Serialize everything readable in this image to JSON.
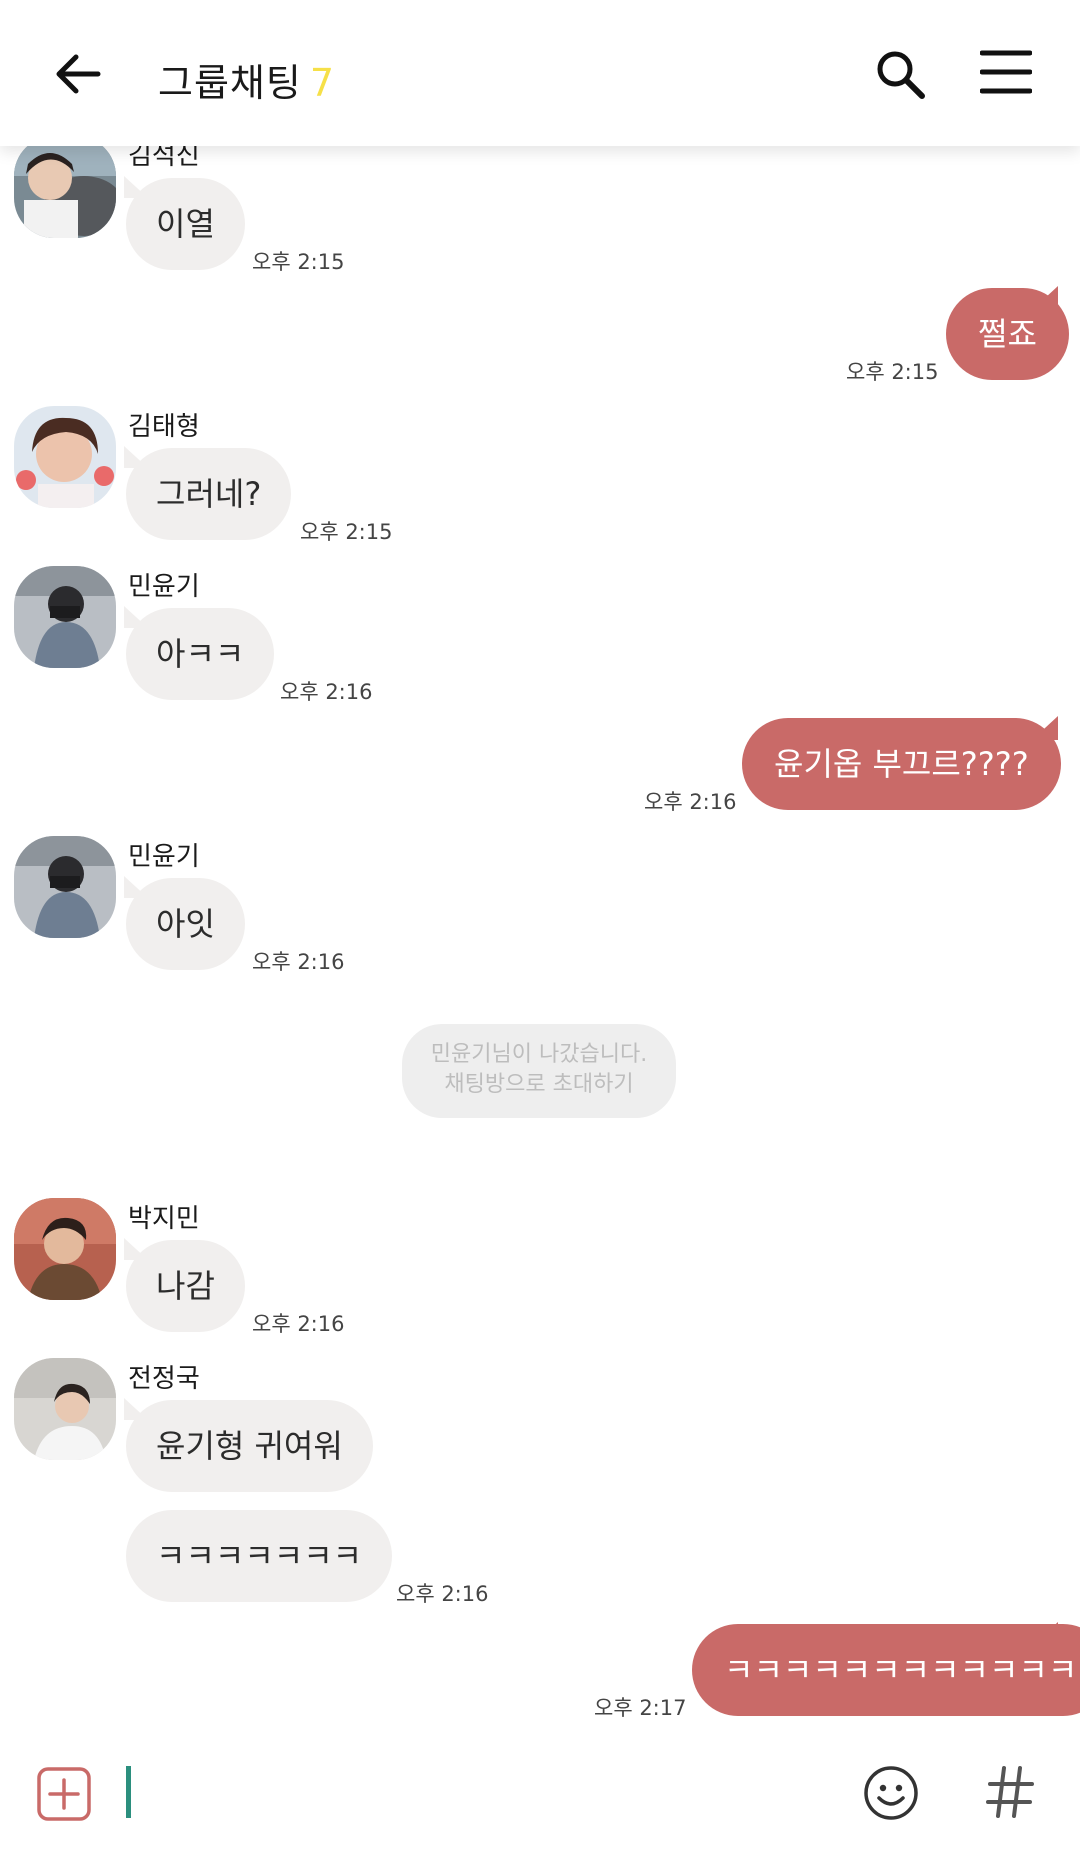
{
  "header": {
    "title": "그룹채팅",
    "member_count": "7",
    "icons": {
      "back": "back-arrow-icon",
      "search": "search-icon",
      "menu": "hamburger-menu-icon"
    }
  },
  "messages": [
    {
      "sender": "김석신",
      "text": "이열",
      "time": "오후 2:15",
      "direction": "in"
    },
    {
      "text": "쩔죠",
      "time": "오후 2:15",
      "direction": "out"
    },
    {
      "sender": "김태형",
      "text": "그러네?",
      "time": "오후 2:15",
      "direction": "in"
    },
    {
      "sender": "민윤기",
      "text": "아ㅋㅋ",
      "time": "오후 2:16",
      "direction": "in"
    },
    {
      "text": "윤기옵 부끄르????",
      "time": "오후 2:16",
      "direction": "out"
    },
    {
      "sender": "민윤기",
      "text": "아잇",
      "time": "오후 2:16",
      "direction": "in"
    },
    {
      "sender": "박지민",
      "text": "나감",
      "time": "오후 2:16",
      "direction": "in"
    },
    {
      "sender": "전정국",
      "text": "윤기형 귀여워",
      "direction": "in"
    },
    {
      "text": "ㅋㅋㅋㅋㅋㅋㅋ",
      "time": "오후 2:16",
      "direction": "in"
    },
    {
      "text": "ㅋㅋㅋㅋㅋㅋㅋㅋㅋㅋㅋㅋ",
      "time": "오후 2:17",
      "direction": "out"
    }
  ],
  "system_notice": {
    "line1": "민윤기님이 나갔습니다.",
    "line2": "채팅방으로 초대하기"
  },
  "bottom_bar": {
    "icons": {
      "plus": "plus-icon",
      "emoji": "emoji-icon",
      "hashtag": "hashtag-icon"
    },
    "input_value": ""
  },
  "colors": {
    "outgoing_bubble": "#c96a68",
    "incoming_bubble": "#f1efee",
    "member_count": "#f6e048",
    "cursor": "#2b8f7e"
  }
}
